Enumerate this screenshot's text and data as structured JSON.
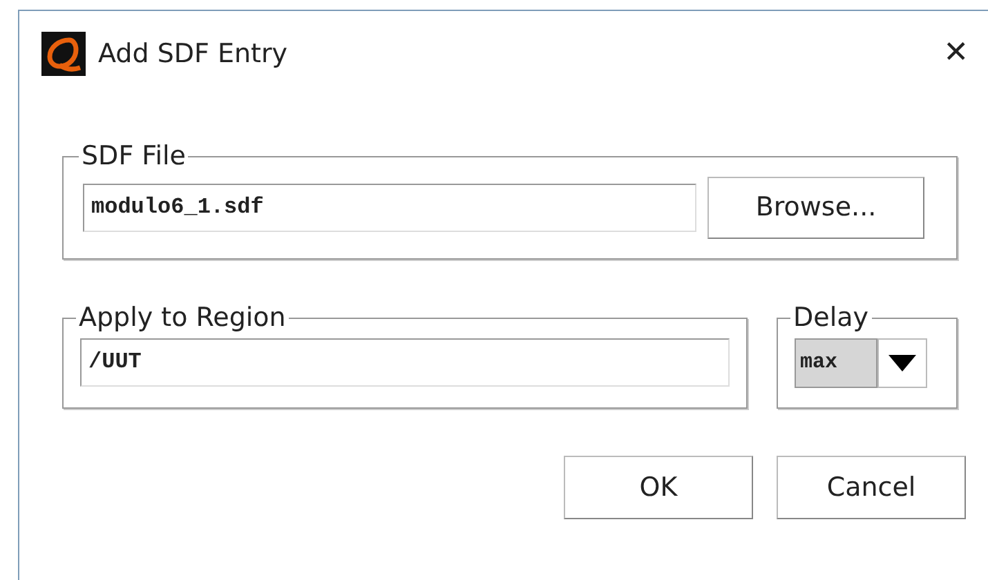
{
  "window": {
    "title": "Add SDF Entry",
    "close": "✕"
  },
  "sdf_file": {
    "legend": "SDF File",
    "value": "modulo6_1.sdf",
    "browse": "Browse..."
  },
  "region": {
    "legend": "Apply to Region",
    "value": "/UUT"
  },
  "delay": {
    "legend": "Delay",
    "value": "max"
  },
  "buttons": [
    "OK",
    "Cancel"
  ]
}
